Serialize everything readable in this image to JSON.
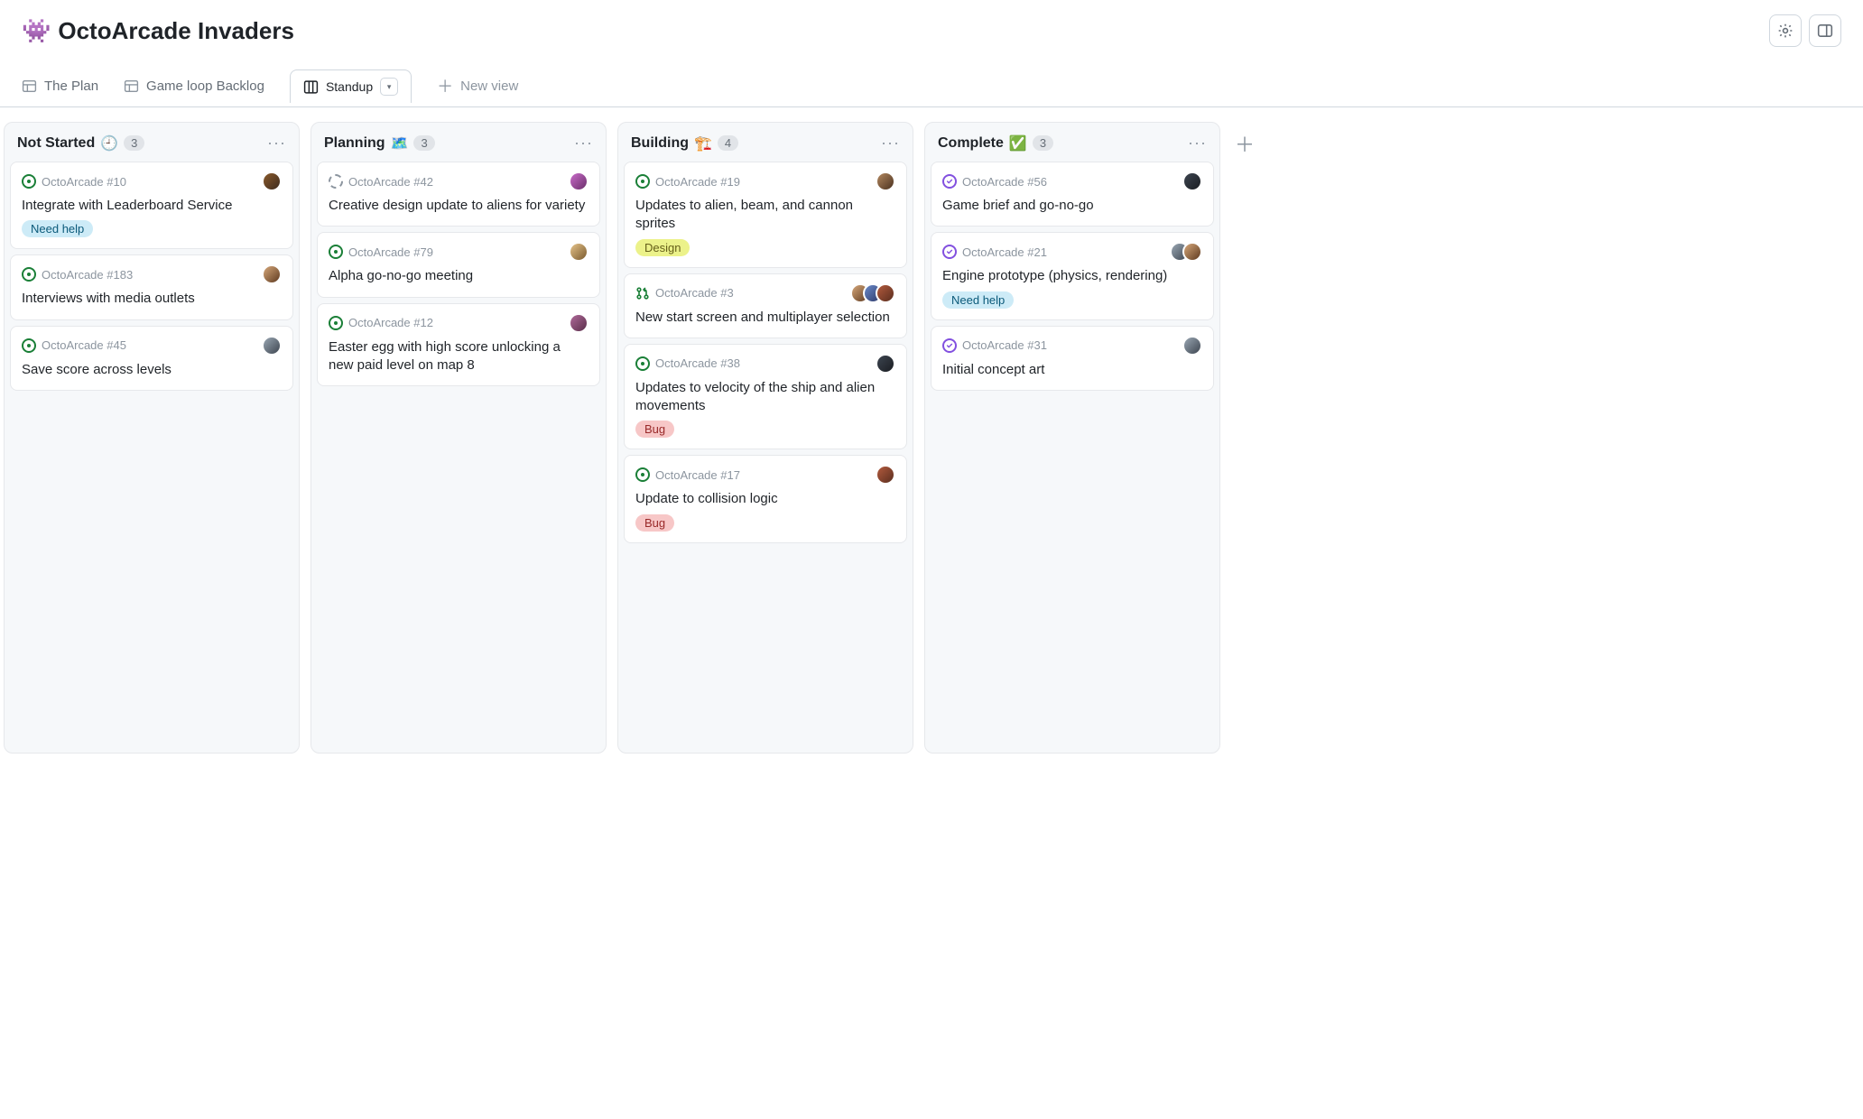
{
  "project": {
    "emoji": "👾",
    "title": "OctoArcade Invaders"
  },
  "tabs": {
    "plan": {
      "label": "The Plan"
    },
    "backlog": {
      "label": "Game loop Backlog"
    },
    "standup": {
      "label": "Standup"
    },
    "new": {
      "label": "New view"
    }
  },
  "columns": [
    {
      "title": "Not Started",
      "emoji": "🕘",
      "count": "3",
      "cards": [
        {
          "status": "open",
          "ref": "OctoArcade #10",
          "title": "Integrate with Leaderboard Service",
          "labels": [
            {
              "text": "Need help",
              "kind": "needhelp"
            }
          ],
          "avatars": [
            "av0"
          ]
        },
        {
          "status": "open",
          "ref": "OctoArcade #183",
          "title": "Interviews with media outlets",
          "labels": [],
          "avatars": [
            "av2"
          ]
        },
        {
          "status": "open",
          "ref": "OctoArcade #45",
          "title": "Save score across levels",
          "labels": [],
          "avatars": [
            "av5"
          ]
        }
      ]
    },
    {
      "title": "Planning",
      "emoji": "🗺️",
      "count": "3",
      "cards": [
        {
          "status": "draft",
          "ref": "OctoArcade #42",
          "title": "Creative design update to aliens for variety",
          "labels": [],
          "avatars": [
            "av1"
          ]
        },
        {
          "status": "open",
          "ref": "OctoArcade #79",
          "title": "Alpha go-no-go meeting",
          "labels": [],
          "avatars": [
            "av4"
          ]
        },
        {
          "status": "open",
          "ref": "OctoArcade #12",
          "title": "Easter egg with high score unlocking a new paid level on map 8",
          "labels": [],
          "avatars": [
            "av6"
          ]
        }
      ]
    },
    {
      "title": "Building",
      "emoji": "🏗️",
      "count": "4",
      "cards": [
        {
          "status": "open",
          "ref": "OctoArcade #19",
          "title": "Updates to alien, beam, and cannon sprites",
          "labels": [
            {
              "text": "Design",
              "kind": "design"
            }
          ],
          "avatars": [
            "av3"
          ]
        },
        {
          "status": "pr",
          "ref": "OctoArcade #3",
          "title": "New start screen and multiplayer selection",
          "labels": [],
          "avatars": [
            "av2",
            "av7",
            "av8"
          ]
        },
        {
          "status": "open",
          "ref": "OctoArcade #38",
          "title": "Updates to velocity of the ship and alien movements",
          "labels": [
            {
              "text": "Bug",
              "kind": "bug"
            }
          ],
          "avatars": [
            "av9"
          ]
        },
        {
          "status": "open",
          "ref": "OctoArcade #17",
          "title": "Update to collision logic",
          "labels": [
            {
              "text": "Bug",
              "kind": "bug"
            }
          ],
          "avatars": [
            "av8"
          ]
        }
      ]
    },
    {
      "title": "Complete",
      "emoji": "✅",
      "count": "3",
      "cards": [
        {
          "status": "closed",
          "ref": "OctoArcade #56",
          "title": "Game brief and go-no-go",
          "labels": [],
          "avatars": [
            "av9"
          ]
        },
        {
          "status": "closed",
          "ref": "OctoArcade #21",
          "title": "Engine prototype (physics, rendering)",
          "labels": [
            {
              "text": "Need help",
              "kind": "needhelp"
            }
          ],
          "avatars": [
            "av5",
            "av2"
          ]
        },
        {
          "status": "closed",
          "ref": "OctoArcade #31",
          "title": "Initial concept art",
          "labels": [],
          "avatars": [
            "av5"
          ]
        }
      ]
    }
  ]
}
